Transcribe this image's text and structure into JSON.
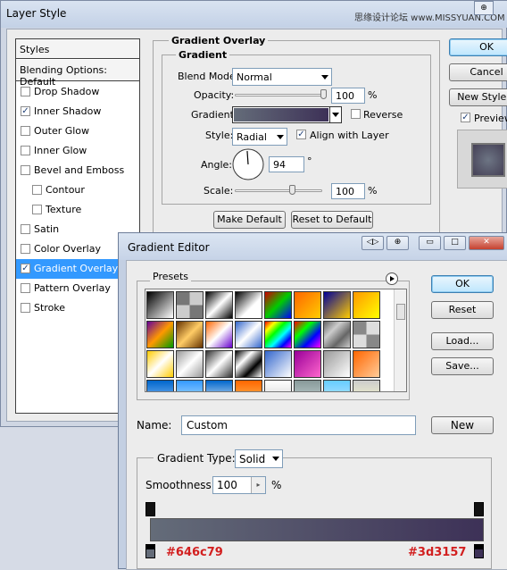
{
  "layer_style": {
    "title": "Layer Style",
    "watermark": "思缘设计论坛 www.MISSYUAN.COM",
    "corner_icon": "⊕",
    "styles_header": "Styles",
    "blending_header": "Blending Options: Default",
    "items": [
      {
        "label": "Drop Shadow",
        "checked": false,
        "indent": false,
        "selected": false
      },
      {
        "label": "Inner Shadow",
        "checked": true,
        "indent": false,
        "selected": false
      },
      {
        "label": "Outer Glow",
        "checked": false,
        "indent": false,
        "selected": false
      },
      {
        "label": "Inner Glow",
        "checked": false,
        "indent": false,
        "selected": false
      },
      {
        "label": "Bevel and Emboss",
        "checked": false,
        "indent": false,
        "selected": false
      },
      {
        "label": "Contour",
        "checked": false,
        "indent": true,
        "selected": false
      },
      {
        "label": "Texture",
        "checked": false,
        "indent": true,
        "selected": false
      },
      {
        "label": "Satin",
        "checked": false,
        "indent": false,
        "selected": false
      },
      {
        "label": "Color Overlay",
        "checked": false,
        "indent": false,
        "selected": false
      },
      {
        "label": "Gradient Overlay",
        "checked": true,
        "indent": false,
        "selected": true
      },
      {
        "label": "Pattern Overlay",
        "checked": false,
        "indent": false,
        "selected": false
      },
      {
        "label": "Stroke",
        "checked": false,
        "indent": false,
        "selected": false
      }
    ],
    "gradient_overlay": {
      "group_title": "Gradient Overlay",
      "subgroup_title": "Gradient",
      "blend_mode_label": "Blend Mode:",
      "blend_mode_value": "Normal",
      "opacity_label": "Opacity:",
      "opacity_value": "100",
      "opacity_level": 1.0,
      "percent": "%",
      "gradient_label": "Gradient:",
      "reverse_label": "Reverse",
      "reverse_checked": false,
      "style_label": "Style:",
      "style_value": "Radial",
      "align_label": "Align with Layer",
      "align_checked": true,
      "angle_label": "Angle:",
      "angle_value": "94",
      "degree": "°",
      "scale_label": "Scale:",
      "scale_value": "100",
      "scale_level": 0.667,
      "make_default": "Make Default",
      "reset_default": "Reset to Default"
    },
    "buttons": {
      "ok": "OK",
      "cancel": "Cancel",
      "new_style": "New Style...",
      "preview": "Preview",
      "preview_checked": true
    }
  },
  "gradient_editor": {
    "title": "Gradient Editor",
    "title_buttons": [
      "◁▷",
      "⊕",
      "▭",
      "□",
      "✕"
    ],
    "presets_label": "Presets",
    "buttons": {
      "ok": "OK",
      "reset": "Reset",
      "load": "Load...",
      "save": "Save...",
      "new": "New"
    },
    "name_label": "Name:",
    "name_value": "Custom",
    "gradient_type_label": "Gradient Type:",
    "gradient_type_value": "Solid",
    "smoothness_label": "Smoothness:",
    "smoothness_value": "100",
    "percent": "%",
    "stop_left_hex": "#646c79",
    "stop_right_hex": "#3d3157"
  },
  "colors": {
    "gradient_start": "#646c79",
    "gradient_end": "#3d3157",
    "selection_blue": "#3399ff",
    "hex_red": "#d21f1f"
  }
}
